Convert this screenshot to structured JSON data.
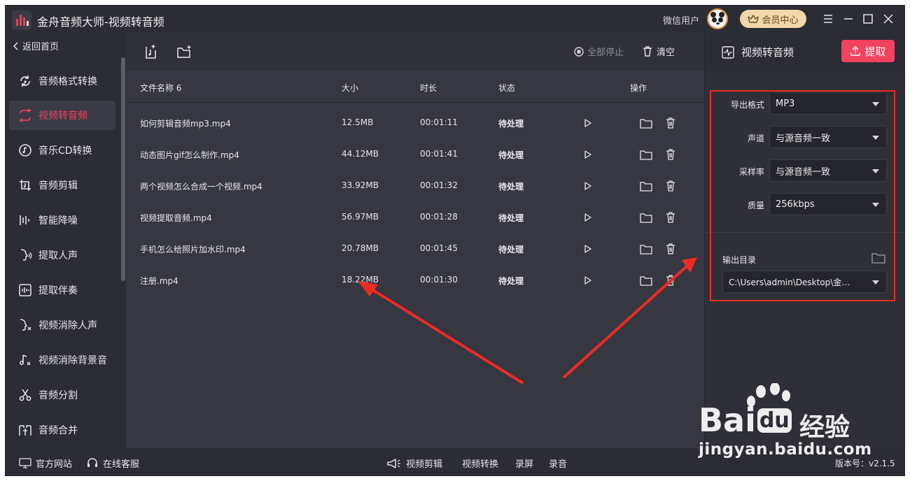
{
  "window": {
    "title": "金舟音频大师-视频转音频",
    "user_name": "微信用户",
    "vip_label": "会员中心"
  },
  "sidebar": {
    "back_label": "返回首页",
    "items": [
      {
        "label": "音频格式转换",
        "icon": "audio-convert-icon"
      },
      {
        "label": "视频转音频",
        "icon": "video-to-audio-icon",
        "active": true
      },
      {
        "label": "音乐CD转换",
        "icon": "cd-icon"
      },
      {
        "label": "音频剪辑",
        "icon": "audio-cut-icon"
      },
      {
        "label": "智能降噪",
        "icon": "noise-reduction-icon"
      },
      {
        "label": "提取人声",
        "icon": "voice-extract-icon"
      },
      {
        "label": "提取伴奏",
        "icon": "accompaniment-icon"
      },
      {
        "label": "视频消除人声",
        "icon": "remove-voice-icon"
      },
      {
        "label": "视频消除背景音",
        "icon": "remove-bg-music-icon"
      },
      {
        "label": "音频分割",
        "icon": "scissors-icon"
      },
      {
        "label": "音频合并",
        "icon": "merge-icon"
      }
    ]
  },
  "toolbar": {
    "stop_all_label": "全部停止",
    "clear_label": "清空"
  },
  "table": {
    "headers": {
      "name": "文件名称 6",
      "size": "大小",
      "duration": "时长",
      "status": "状态",
      "actions": "操作"
    },
    "rows": [
      {
        "name": "如何剪辑音频mp3.mp4",
        "size": "12.5MB",
        "duration": "00:01:11",
        "status": "待处理"
      },
      {
        "name": "动态图片gif怎么制作.mp4",
        "size": "44.12MB",
        "duration": "00:01:41",
        "status": "待处理"
      },
      {
        "name": "两个视频怎么合成一个视频.mp4",
        "size": "33.92MB",
        "duration": "00:01:32",
        "status": "待处理"
      },
      {
        "name": "视频提取音频.mp4",
        "size": "56.97MB",
        "duration": "00:01:28",
        "status": "待处理"
      },
      {
        "name": "手机怎么给照片加水印.mp4",
        "size": "20.78MB",
        "duration": "00:01:45",
        "status": "待处理"
      },
      {
        "name": "注册.mp4",
        "size": "18.22MB",
        "duration": "00:01:30",
        "status": "待处理"
      }
    ]
  },
  "panel": {
    "title": "视频转音频",
    "extract_label": "提取",
    "settings": [
      {
        "label": "导出格式",
        "value": "MP3"
      },
      {
        "label": "声道",
        "value": "与源音频一致"
      },
      {
        "label": "采样率",
        "value": "与源音频一致"
      },
      {
        "label": "质量",
        "value": "256kbps"
      }
    ],
    "output_label": "输出目录",
    "output_path": "C:\\Users\\admin\\Desktop\\金舟..."
  },
  "bottombar": {
    "website_label": "官方网站",
    "service_label": "在线客服",
    "video_edit_label": "视频剪辑",
    "video_convert_label": "视频转换",
    "screen_record_label": "录屏",
    "audio_record_label": "录音",
    "version": "版本号：v2.1.5"
  },
  "watermark": {
    "brand": "Bai",
    "brand_du": "du",
    "brand_cn": "经验",
    "url": "jingyan.baidu.com"
  },
  "colors": {
    "accent": "#f2425e",
    "annotation_red": "#ee2a24",
    "background": "#2b2c34",
    "list_background": "#363740"
  }
}
